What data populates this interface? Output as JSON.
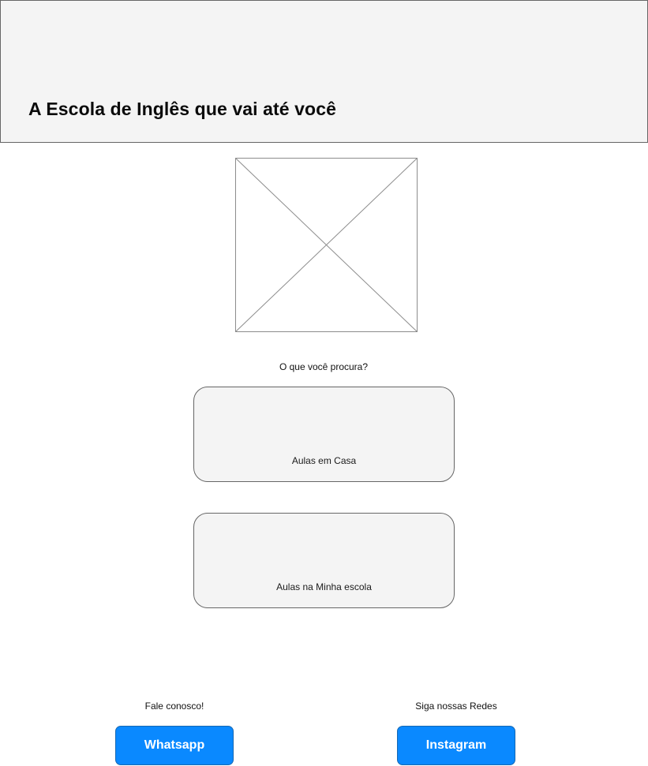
{
  "header": {
    "title": "A Escola de Inglês que vai até você"
  },
  "hero": {
    "image": "image-placeholder"
  },
  "main": {
    "question": "O que você procura?",
    "options": [
      {
        "label": "Aulas em Casa"
      },
      {
        "label": "Aulas na Minha escola"
      }
    ]
  },
  "footer": {
    "contact_caption": "Fale conosco!",
    "social_caption": "Siga nossas Redes",
    "whatsapp_label": "Whatsapp",
    "instagram_label": "Instagram"
  },
  "colors": {
    "header_bg": "#f4f4f4",
    "card_bg": "#f4f4f4",
    "border": "#666666",
    "button_bg": "#0a89ff",
    "button_text": "#ffffff"
  }
}
